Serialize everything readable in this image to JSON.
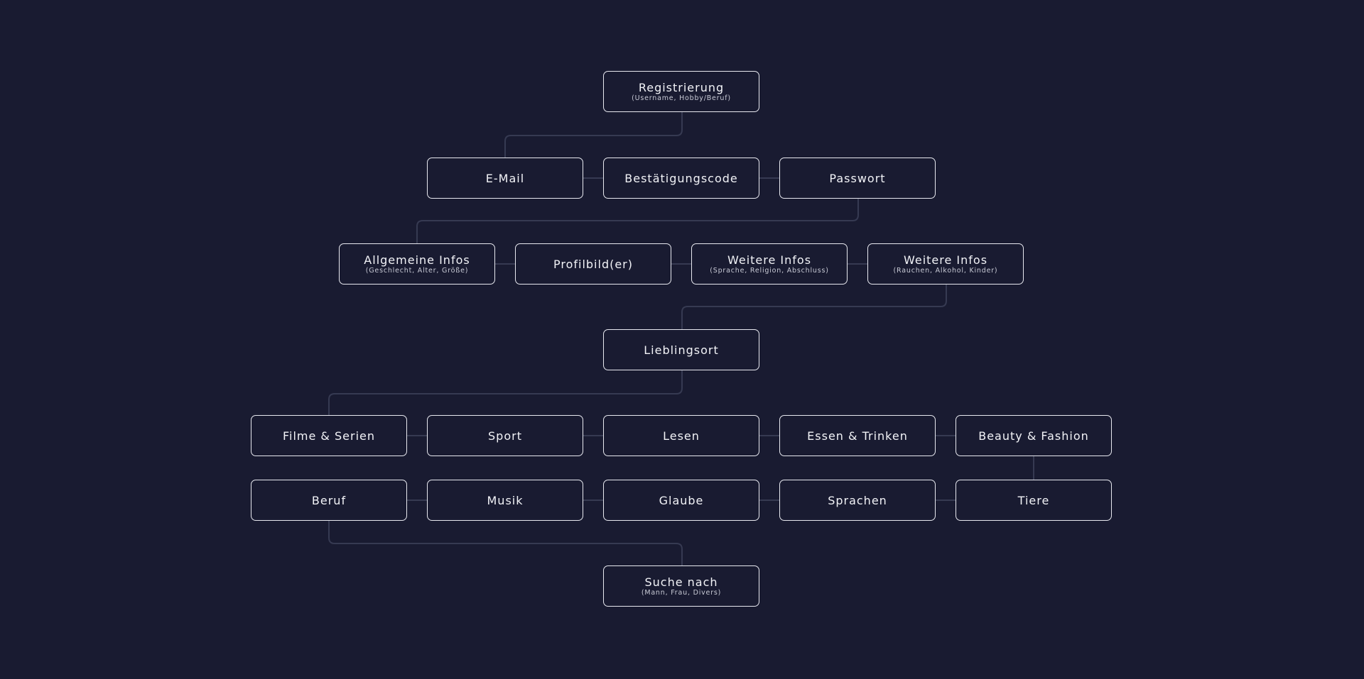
{
  "diagram": {
    "line_color": "#363a52",
    "border_color": "#e8e9f0",
    "background": "#191b31",
    "nodes": [
      {
        "id": "registrierung",
        "title": "Registrierung",
        "subtitle": "(Username, Hobby/Beruf)"
      },
      {
        "id": "email",
        "title": "E-Mail",
        "subtitle": ""
      },
      {
        "id": "bestaetigungscode",
        "title": "Bestätigungscode",
        "subtitle": ""
      },
      {
        "id": "passwort",
        "title": "Passwort",
        "subtitle": ""
      },
      {
        "id": "allgemeine-infos",
        "title": "Allgemeine Infos",
        "subtitle": "(Geschlecht, Alter, Größe)"
      },
      {
        "id": "profilbild",
        "title": "Profilbild(er)",
        "subtitle": ""
      },
      {
        "id": "weitere-infos-1",
        "title": "Weitere Infos",
        "subtitle": "(Sprache, Religion, Abschluss)"
      },
      {
        "id": "weitere-infos-2",
        "title": "Weitere Infos",
        "subtitle": "(Rauchen, Alkohol, Kinder)"
      },
      {
        "id": "lieblingsort",
        "title": "Lieblingsort",
        "subtitle": ""
      },
      {
        "id": "filme-serien",
        "title": "Filme & Serien",
        "subtitle": ""
      },
      {
        "id": "sport",
        "title": "Sport",
        "subtitle": ""
      },
      {
        "id": "lesen",
        "title": "Lesen",
        "subtitle": ""
      },
      {
        "id": "essen-trinken",
        "title": "Essen & Trinken",
        "subtitle": ""
      },
      {
        "id": "beauty-fashion",
        "title": "Beauty & Fashion",
        "subtitle": ""
      },
      {
        "id": "beruf",
        "title": "Beruf",
        "subtitle": ""
      },
      {
        "id": "musik",
        "title": "Musik",
        "subtitle": ""
      },
      {
        "id": "glaube",
        "title": "Glaube",
        "subtitle": ""
      },
      {
        "id": "sprachen",
        "title": "Sprachen",
        "subtitle": ""
      },
      {
        "id": "tiere",
        "title": "Tiere",
        "subtitle": ""
      },
      {
        "id": "suche-nach",
        "title": "Suche nach",
        "subtitle": "(Mann, Frau, Divers)"
      }
    ]
  }
}
